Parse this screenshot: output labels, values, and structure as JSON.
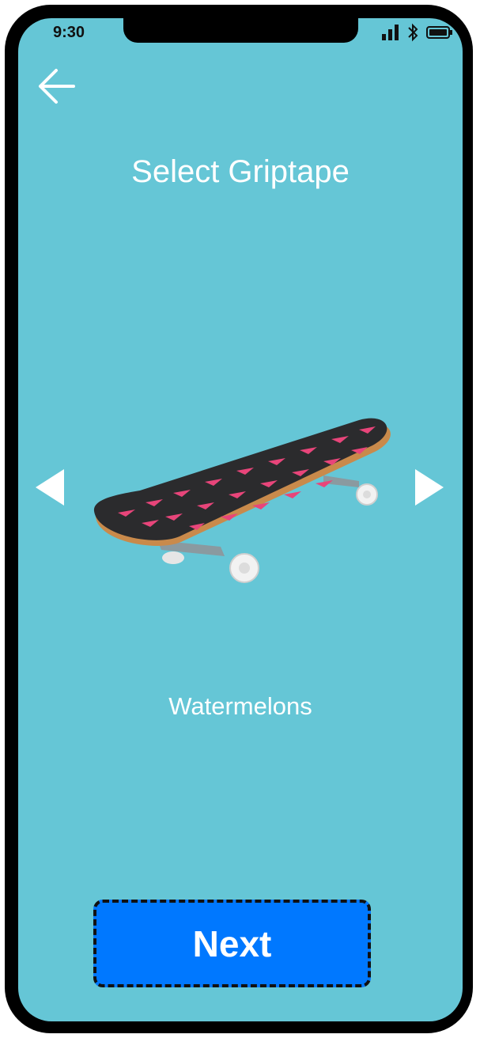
{
  "status_bar": {
    "time": "9:30",
    "icons": [
      "signal-icon",
      "bluetooth-icon",
      "battery-icon"
    ]
  },
  "header": {
    "back_icon": "back-arrow-icon",
    "title": "Select Griptape"
  },
  "carousel": {
    "prev_icon": "triangle-left-icon",
    "next_icon": "triangle-right-icon",
    "item_image": "skateboard-watermelon-griptape",
    "item_name": "Watermelons"
  },
  "footer": {
    "next_label": "Next"
  },
  "colors": {
    "background": "#65c6d6",
    "button": "#0078ff",
    "text": "#ffffff",
    "frame": "#000000"
  }
}
